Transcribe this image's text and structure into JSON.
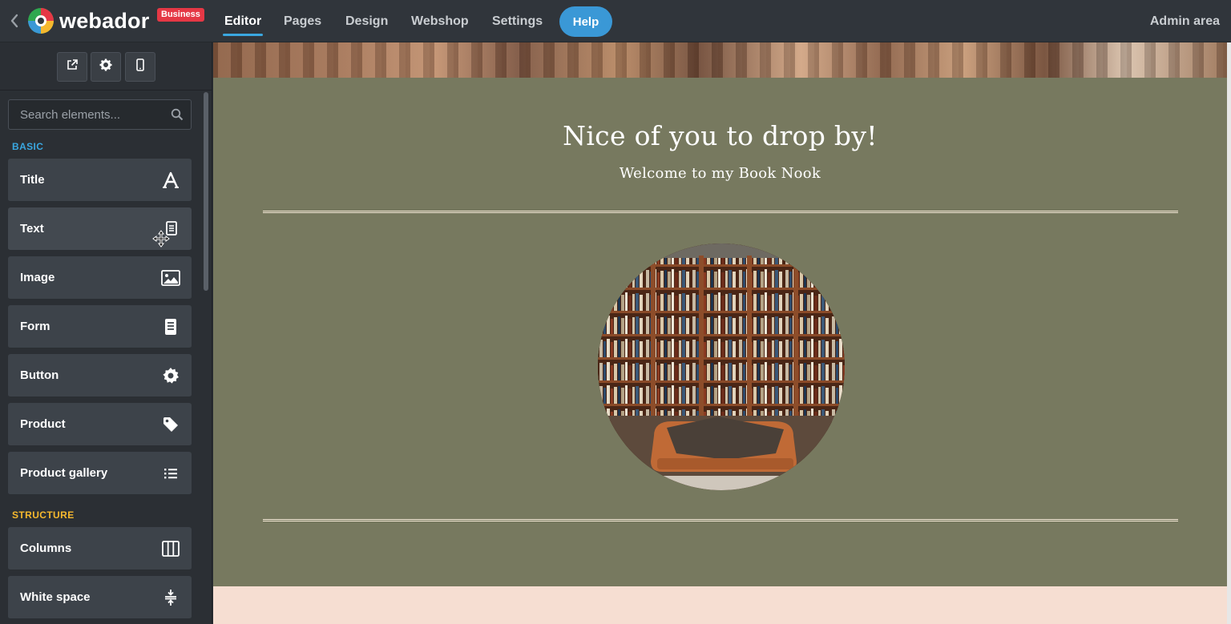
{
  "topbar": {
    "brand": "webador",
    "badge": "Business",
    "tabs": [
      {
        "label": "Editor",
        "active": true
      },
      {
        "label": "Pages"
      },
      {
        "label": "Design"
      },
      {
        "label": "Webshop"
      },
      {
        "label": "Settings"
      }
    ],
    "help_label": "Help",
    "admin_label": "Admin area",
    "accent_color": "#3aa7e0"
  },
  "sidebar": {
    "tools": [
      {
        "icon": "external-link-icon"
      },
      {
        "icon": "gear-icon"
      },
      {
        "icon": "mobile-icon"
      }
    ],
    "search": {
      "placeholder": "Search elements..."
    },
    "sections": [
      {
        "label": "BASIC",
        "color": "#3aa7e0",
        "items": [
          {
            "label": "Title",
            "icon": "title-icon"
          },
          {
            "label": "Text",
            "icon": "text-icon"
          },
          {
            "label": "Image",
            "icon": "image-icon"
          },
          {
            "label": "Form",
            "icon": "form-icon"
          },
          {
            "label": "Button",
            "icon": "button-icon"
          },
          {
            "label": "Product",
            "icon": "tag-icon"
          },
          {
            "label": "Product gallery",
            "icon": "list-icon"
          }
        ]
      },
      {
        "label": "STRUCTURE",
        "color": "#f5b82e",
        "items": [
          {
            "label": "Columns",
            "icon": "columns-icon"
          },
          {
            "label": "White space",
            "icon": "white-space-icon"
          }
        ]
      }
    ]
  },
  "canvas": {
    "hero_title": "Nice of you to drop by!",
    "hero_subtitle": "Welcome to my Book Nook",
    "background": "#77795f",
    "footer_color": "#f6ded2"
  }
}
